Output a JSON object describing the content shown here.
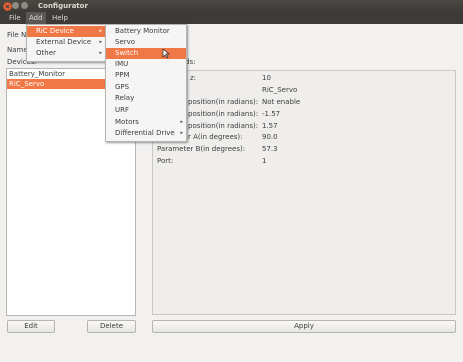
{
  "window": {
    "title": "Configurator"
  },
  "menubar": {
    "items": [
      "File",
      "Add",
      "Help"
    ]
  },
  "left_panel": {
    "file_label": "File N",
    "name_label": "Name",
    "devices_label": "Devices:",
    "devices": [
      "Battery_Monitor",
      "RiC_Servo"
    ],
    "selected_device": "RiC_Servo",
    "edit_button": "Edit",
    "delete_button": "Delete"
  },
  "right_panel": {
    "fields_header_fragment": "ds:",
    "apply_button": "Apply",
    "properties": [
      {
        "label": "z:",
        "value": "10"
      },
      {
        "label": "",
        "value": "RiC_Servo"
      },
      {
        "label": "position(in radians):",
        "value": "Not enable"
      },
      {
        "label": "position(in radians):",
        "value": "-1.57"
      },
      {
        "label": "position(in radians):",
        "value": "1.57"
      },
      {
        "label": "r A(in degrees):",
        "value": "90.0"
      },
      {
        "label": "Parameter B(in degrees):",
        "value": "57.3"
      },
      {
        "label": "Port:",
        "value": "1"
      }
    ]
  },
  "add_menu": {
    "items": [
      {
        "label": "RiC Device",
        "submenu": true,
        "highlighted": true
      },
      {
        "label": "External Device",
        "submenu": true,
        "highlighted": false
      },
      {
        "label": "Other",
        "submenu": true,
        "highlighted": false
      }
    ]
  },
  "ric_device_submenu": {
    "items": [
      {
        "label": "Battery Monitor",
        "submenu": false
      },
      {
        "label": "Servo",
        "submenu": false
      },
      {
        "label": "Switch",
        "submenu": false,
        "highlighted": true
      },
      {
        "label": "IMU",
        "submenu": false
      },
      {
        "label": "PPM",
        "submenu": false
      },
      {
        "label": "GPS",
        "submenu": false
      },
      {
        "label": "Relay",
        "submenu": false
      },
      {
        "label": "URF",
        "submenu": false
      },
      {
        "label": "Motors",
        "submenu": true
      },
      {
        "label": "Differential Drive",
        "submenu": true
      }
    ]
  },
  "colors": {
    "accent": "#f07746",
    "titlebar": "#3c3b37",
    "background": "#f2f1f0"
  }
}
